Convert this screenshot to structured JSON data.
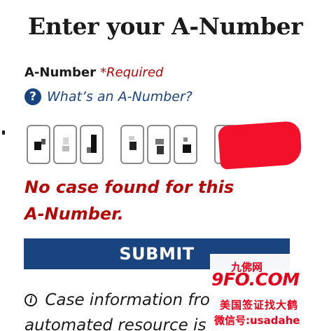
{
  "page": {
    "title": "Enter your A-Number"
  },
  "field": {
    "label": "A-Number",
    "required_text": "*Required"
  },
  "help": {
    "icon_glyph": "?",
    "link_text": "What’s an A-Number?"
  },
  "digits": {
    "count": 9,
    "content": "redacted"
  },
  "error": {
    "message": "No case found for this A-Number."
  },
  "submit": {
    "label": "SUBMIT"
  },
  "info": {
    "icon_glyph": "i",
    "line1": "Case information from",
    "line2": "automated resource is pr"
  },
  "watermark": {
    "site_name": "九佛网",
    "logo": "9FO.COM",
    "line1": "美国签证找大鹤",
    "line2": "微信号:usadahe"
  },
  "colors": {
    "primary": "#1a4480",
    "error": "#b50909",
    "text": "#1b1b1b",
    "redaction": "#f2102a",
    "watermark": "#e4001b"
  }
}
